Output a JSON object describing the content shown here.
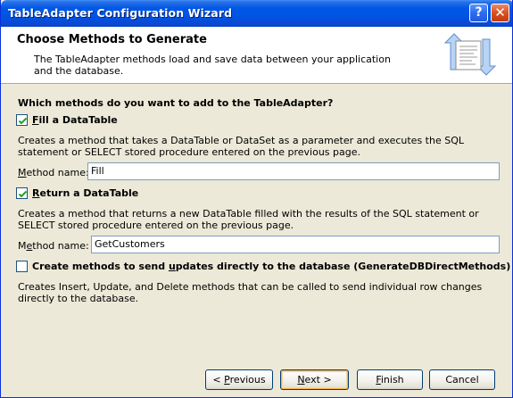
{
  "window": {
    "title": "TableAdapter Configuration Wizard",
    "help_glyph": "?",
    "close_glyph": "✕"
  },
  "header": {
    "title": "Choose Methods to Generate",
    "description": "The TableAdapter methods load and save data between your application and the database.",
    "icon": "wizard-methods-icon"
  },
  "main": {
    "question": "Which methods do you want to add to the TableAdapter?",
    "fill": {
      "checked": true,
      "label_pre": "",
      "label_accel": "F",
      "label_post": "ill a DataTable",
      "description": "Creates a method that takes a DataTable or DataSet as a parameter and executes the SQL statement or SELECT stored procedure entered on the previous page.",
      "name_label_accel": "M",
      "name_label_post": "ethod name:",
      "name_value": "Fill"
    },
    "return": {
      "checked": true,
      "label_pre": "",
      "label_accel": "R",
      "label_post": "eturn a DataTable",
      "description": "Creates a method that returns a new DataTable filled with the results of the SQL statement or SELECT stored procedure entered on the previous page.",
      "name_label_pre": "M",
      "name_label_accel": "e",
      "name_label_post": "thod name:",
      "name_value": "GetCustomers"
    },
    "direct": {
      "checked": false,
      "label_pre": "Create methods to send ",
      "label_accel": "u",
      "label_post": "pdates directly to the database (GenerateDBDirectMethods)",
      "description": "Creates Insert, Update, and Delete methods that can be called to send individual row changes directly to the database."
    }
  },
  "buttons": {
    "previous_pre": "< ",
    "previous_accel": "P",
    "previous_post": "revious",
    "next_accel": "N",
    "next_post": "ext >",
    "finish_accel": "F",
    "finish_post": "inish",
    "cancel": "Cancel"
  },
  "colors": {
    "titlebar": "#0054e3",
    "dialog_bg": "#ece9d8",
    "header_bg": "#ffffff",
    "check": "#21a121"
  }
}
